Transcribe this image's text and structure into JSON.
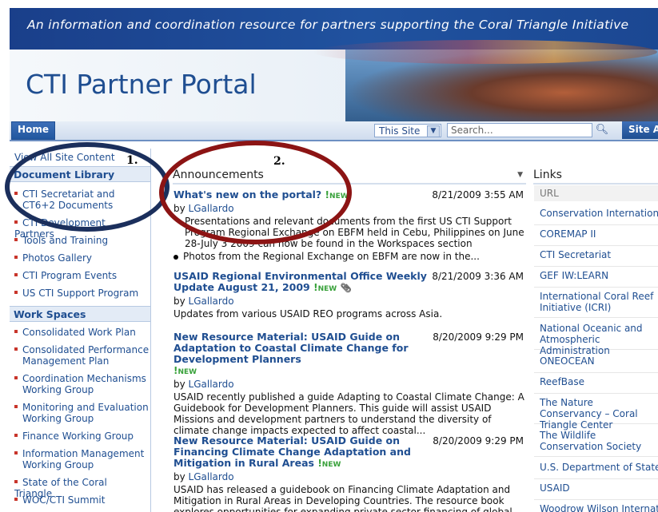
{
  "banner": {
    "tagline": "An information and coordination resource for partners supporting the Coral Triangle Initiative",
    "site_title": "CTI Partner Portal"
  },
  "nav": {
    "home_tab": "Home",
    "scope": "This Site",
    "search_placeholder": "Search...",
    "site_actions": "Site Actions"
  },
  "leftnav": {
    "view_all": "View All Site Content",
    "doc_library_header": "Document Library",
    "doc_items": [
      "CTI Secretariat and CT6+2 Documents",
      "CTI Development Partners",
      "Tools and Training",
      "Photos Gallery",
      "CTI Program Events",
      "US CTI Support Program"
    ],
    "workspaces_header": "Work Spaces",
    "work_items": [
      "Consolidated Work Plan",
      "Consolidated Performance Management Plan",
      "Coordination Mechanisms Working Group",
      "Monitoring and Evaluation Working Group",
      "Finance Working Group",
      "Information Management Working Group",
      "State of the Coral Triangle",
      "WOC/CTI Summit"
    ]
  },
  "announcements": {
    "header": "Announcements",
    "new_label": "NEW",
    "items": [
      {
        "title": "What's new on the portal?",
        "date": "8/21/2009 3:55 AM",
        "by": "by",
        "author": "LGallardo",
        "body1": "Presentations and relevant documents from the first US CTI Support Program Regional Exchange on EBFM held in Cebu, Philippines on June 28-July 3 2009 can now be found in the Workspaces section",
        "body2": "Photos from the Regional Exchange on EBFM are now in the..."
      },
      {
        "title": "USAID Regional Environmental Office Weekly Update August 21, 2009",
        "date": "8/21/2009 3:36 AM",
        "by": "by",
        "author": "LGallardo",
        "body": "Updates from various USAID REO programs across Asia."
      },
      {
        "title": "New Resource Material: USAID Guide on Adaptation to Coastal Climate Change for Development Planners",
        "date": "8/20/2009 9:29 PM",
        "by": "by",
        "author": "LGallardo",
        "body": "USAID recently published a guide Adapting to Coastal Climate Change: A Guidebook for Development Planners. This guide will assist USAID Missions and development partners to understand the diversity of climate change impacts expected to affect coastal..."
      },
      {
        "title": "New Resource Material: USAID Guide on Financing Climate Change Adaptation and Mitigation in Rural Areas",
        "date": "8/20/2009 9:29 PM",
        "by": "by",
        "author": "LGallardo",
        "body": "USAID has released a guidebook on Financing Climate Adaptation and Mitigation in Rural Areas in Developing Countries. The resource book explores opportunities for expanding private sector financing of global climate change adaptation (adjusting"
      }
    ]
  },
  "links": {
    "header": "Links",
    "column": "URL",
    "items": [
      "Conservation International",
      "COREMAP II",
      "CTI Secretariat",
      "GEF IW:LEARN",
      "International Coral Reef Initiative (ICRI)",
      "National Oceanic and Atmospheric Administration",
      "ONEOCEAN",
      "ReefBase",
      "The Nature Conservancy – Coral Triangle Center",
      "The Wildlife Conservation Society",
      "U.S. Department of State",
      "USAID",
      "Woodrow Wilson International"
    ]
  },
  "annotations": {
    "label1": "1.",
    "label2": "2.",
    "oval1_color": "#1b2f5c",
    "oval2_color": "#8c1414"
  }
}
